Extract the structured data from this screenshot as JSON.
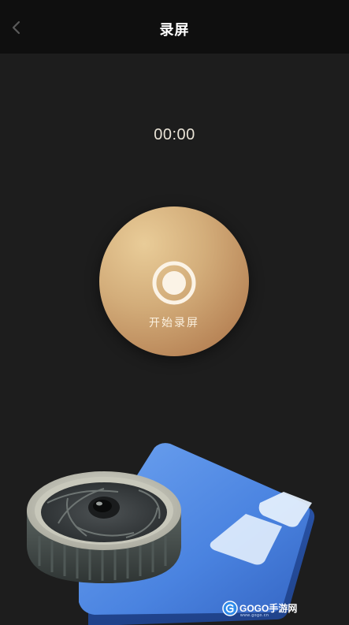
{
  "header": {
    "title": "录屏",
    "back_icon": "chevron-left-icon"
  },
  "timer": {
    "value": "00:00"
  },
  "record": {
    "label": "开始录屏",
    "icon": "record-icon"
  },
  "illustration": {
    "icon": "camera-screen-illustration"
  },
  "watermark": {
    "brand": "GOGO手游网",
    "url": "www.gogo.cn"
  },
  "colors": {
    "background": "#1d1d1d",
    "header_background": "#0f0f0f",
    "accent_gold": "#d3ad7a",
    "timer_text": "#e9e3d6"
  }
}
